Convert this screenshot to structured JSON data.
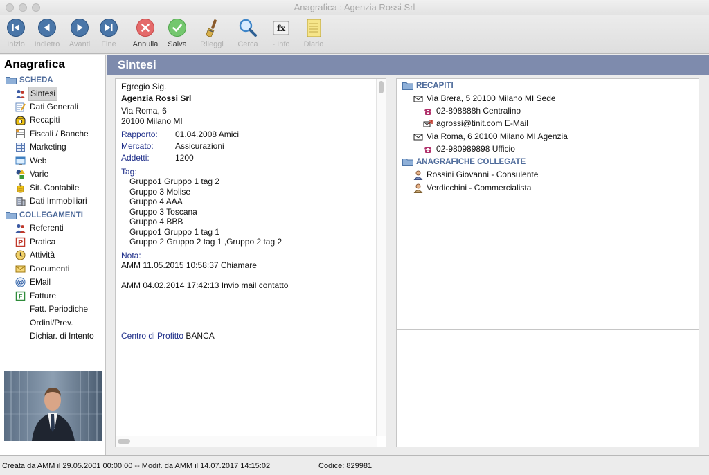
{
  "window": {
    "title": "Anagrafica : Agenzia Rossi Srl"
  },
  "toolbar": {
    "buttons": [
      {
        "id": "inizio",
        "label": "Inizio",
        "icon": "first-icon",
        "enabled": false
      },
      {
        "id": "indietro",
        "label": "Indietro",
        "icon": "back-icon",
        "enabled": false
      },
      {
        "id": "avanti",
        "label": "Avanti",
        "icon": "forward-icon",
        "enabled": false
      },
      {
        "id": "fine",
        "label": "Fine",
        "icon": "last-icon",
        "enabled": false
      },
      {
        "id": "annulla",
        "label": "Annulla",
        "icon": "cancel-icon",
        "enabled": true
      },
      {
        "id": "salva",
        "label": "Salva",
        "icon": "save-icon",
        "enabled": true
      },
      {
        "id": "rileggi",
        "label": "Rileggi",
        "icon": "brush-icon",
        "enabled": false
      },
      {
        "id": "cerca",
        "label": "Cerca",
        "icon": "magnifier-icon",
        "enabled": false
      },
      {
        "id": "info",
        "label": "- Info",
        "icon": "info-icon",
        "enabled": false
      },
      {
        "id": "diario",
        "label": "Diario",
        "icon": "notepad-icon",
        "enabled": false
      }
    ]
  },
  "sidebar": {
    "title": "Anagrafica",
    "scheda_label": "SCHEDA",
    "scheda_items": [
      {
        "label": "Sintesi",
        "icon": "people-icon",
        "selected": true
      },
      {
        "label": "Dati Generali",
        "icon": "edit-form-icon"
      },
      {
        "label": "Recapiti",
        "icon": "telephone-icon"
      },
      {
        "label": "Fiscali / Banche",
        "icon": "ledger-icon"
      },
      {
        "label": "Marketing",
        "icon": "grid-icon"
      },
      {
        "label": "Web",
        "icon": "web-icon"
      },
      {
        "label": "Varie",
        "icon": "shapes-icon"
      },
      {
        "label": "Sit. Contabile",
        "icon": "coins-icon"
      },
      {
        "label": "Dati Immobiliari",
        "icon": "building-icon"
      }
    ],
    "collegamenti_label": "COLLEGAMENTI",
    "collegamenti_items": [
      {
        "label": "Referenti",
        "icon": "people-icon"
      },
      {
        "label": "Pratica",
        "icon": "pratica-p-icon"
      },
      {
        "label": "Attività",
        "icon": "clock-icon"
      },
      {
        "label": "Documenti",
        "icon": "envelope-icon"
      },
      {
        "label": "EMail",
        "icon": "at-icon"
      },
      {
        "label": "Fatture",
        "icon": "fatture-f-icon"
      },
      {
        "label": "Fatt. Periodiche",
        "icon": ""
      },
      {
        "label": "Ordini/Prev.",
        "icon": ""
      },
      {
        "label": "Dichiar. di Intento",
        "icon": ""
      }
    ]
  },
  "header": {
    "title": "Sintesi"
  },
  "summary": {
    "salutation": "Egregio Sig.",
    "company": "Agenzia Rossi Srl",
    "address_line1": "Via Roma, 6",
    "address_line2": "20100 Milano MI",
    "fields": [
      {
        "label": "Rapporto:",
        "value": "01.04.2008 Amici"
      },
      {
        "label": "Mercato:",
        "value": "Assicurazioni"
      },
      {
        "label": "Addetti:",
        "value": "1200"
      }
    ],
    "tag_label": "Tag:",
    "tags": [
      "Gruppo1 Gruppo 1 tag 2",
      "Gruppo 3 Molise",
      "Gruppo 4 AAA",
      "Gruppo 3 Toscana",
      "Gruppo 4 BBB",
      "Gruppo1 Gruppo 1 tag 1",
      "Gruppo 2 Gruppo 2 tag 1 ,Gruppo 2 tag 2"
    ],
    "nota_label": "Nota:",
    "notes": [
      "AMM 11.05.2015 10:58:37 Chiamare",
      "AMM 04.02.2014 17:42:13 Invio mail contatto"
    ],
    "profit_center_label": "Centro di Profitto",
    "profit_center_value": "BANCA"
  },
  "recapiti": {
    "section_label": "RECAPITI",
    "rows": [
      {
        "text": "Via Brera, 5 20100 Milano MI  Sede",
        "icon": "envelope-icon",
        "level": 0
      },
      {
        "text": "02-898888h Centralino",
        "icon": "telephone-icon",
        "level": 1
      },
      {
        "text": "agrossi@tinit.com E-Mail",
        "icon": "email-icon",
        "level": 1
      },
      {
        "text": "Via Roma, 6 20100 Milano MI  Agenzia",
        "icon": "envelope-icon",
        "level": 0
      },
      {
        "text": "02-980989898 Ufficio",
        "icon": "telephone-icon",
        "level": 1
      }
    ]
  },
  "anagrafiche_collegate": {
    "section_label": "ANAGRAFICHE COLLEGATE",
    "rows": [
      {
        "text": "Rossini Giovanni - Consulente",
        "icon": "person-icon"
      },
      {
        "text": "Verdicchini - Commercialista",
        "icon": "person-icon"
      }
    ]
  },
  "status": {
    "created_modified": "Creata da AMM il 29.05.2001 00:00:00 -- Modif. da AMM il 14.07.2017 14:15:02",
    "codice": "Codice: 829981"
  },
  "colors": {
    "header_band": "#7e8bad",
    "section_blue": "#4d6a9a",
    "label_blue": "#1f2f8a",
    "phone_magenta": "#b0306a"
  }
}
